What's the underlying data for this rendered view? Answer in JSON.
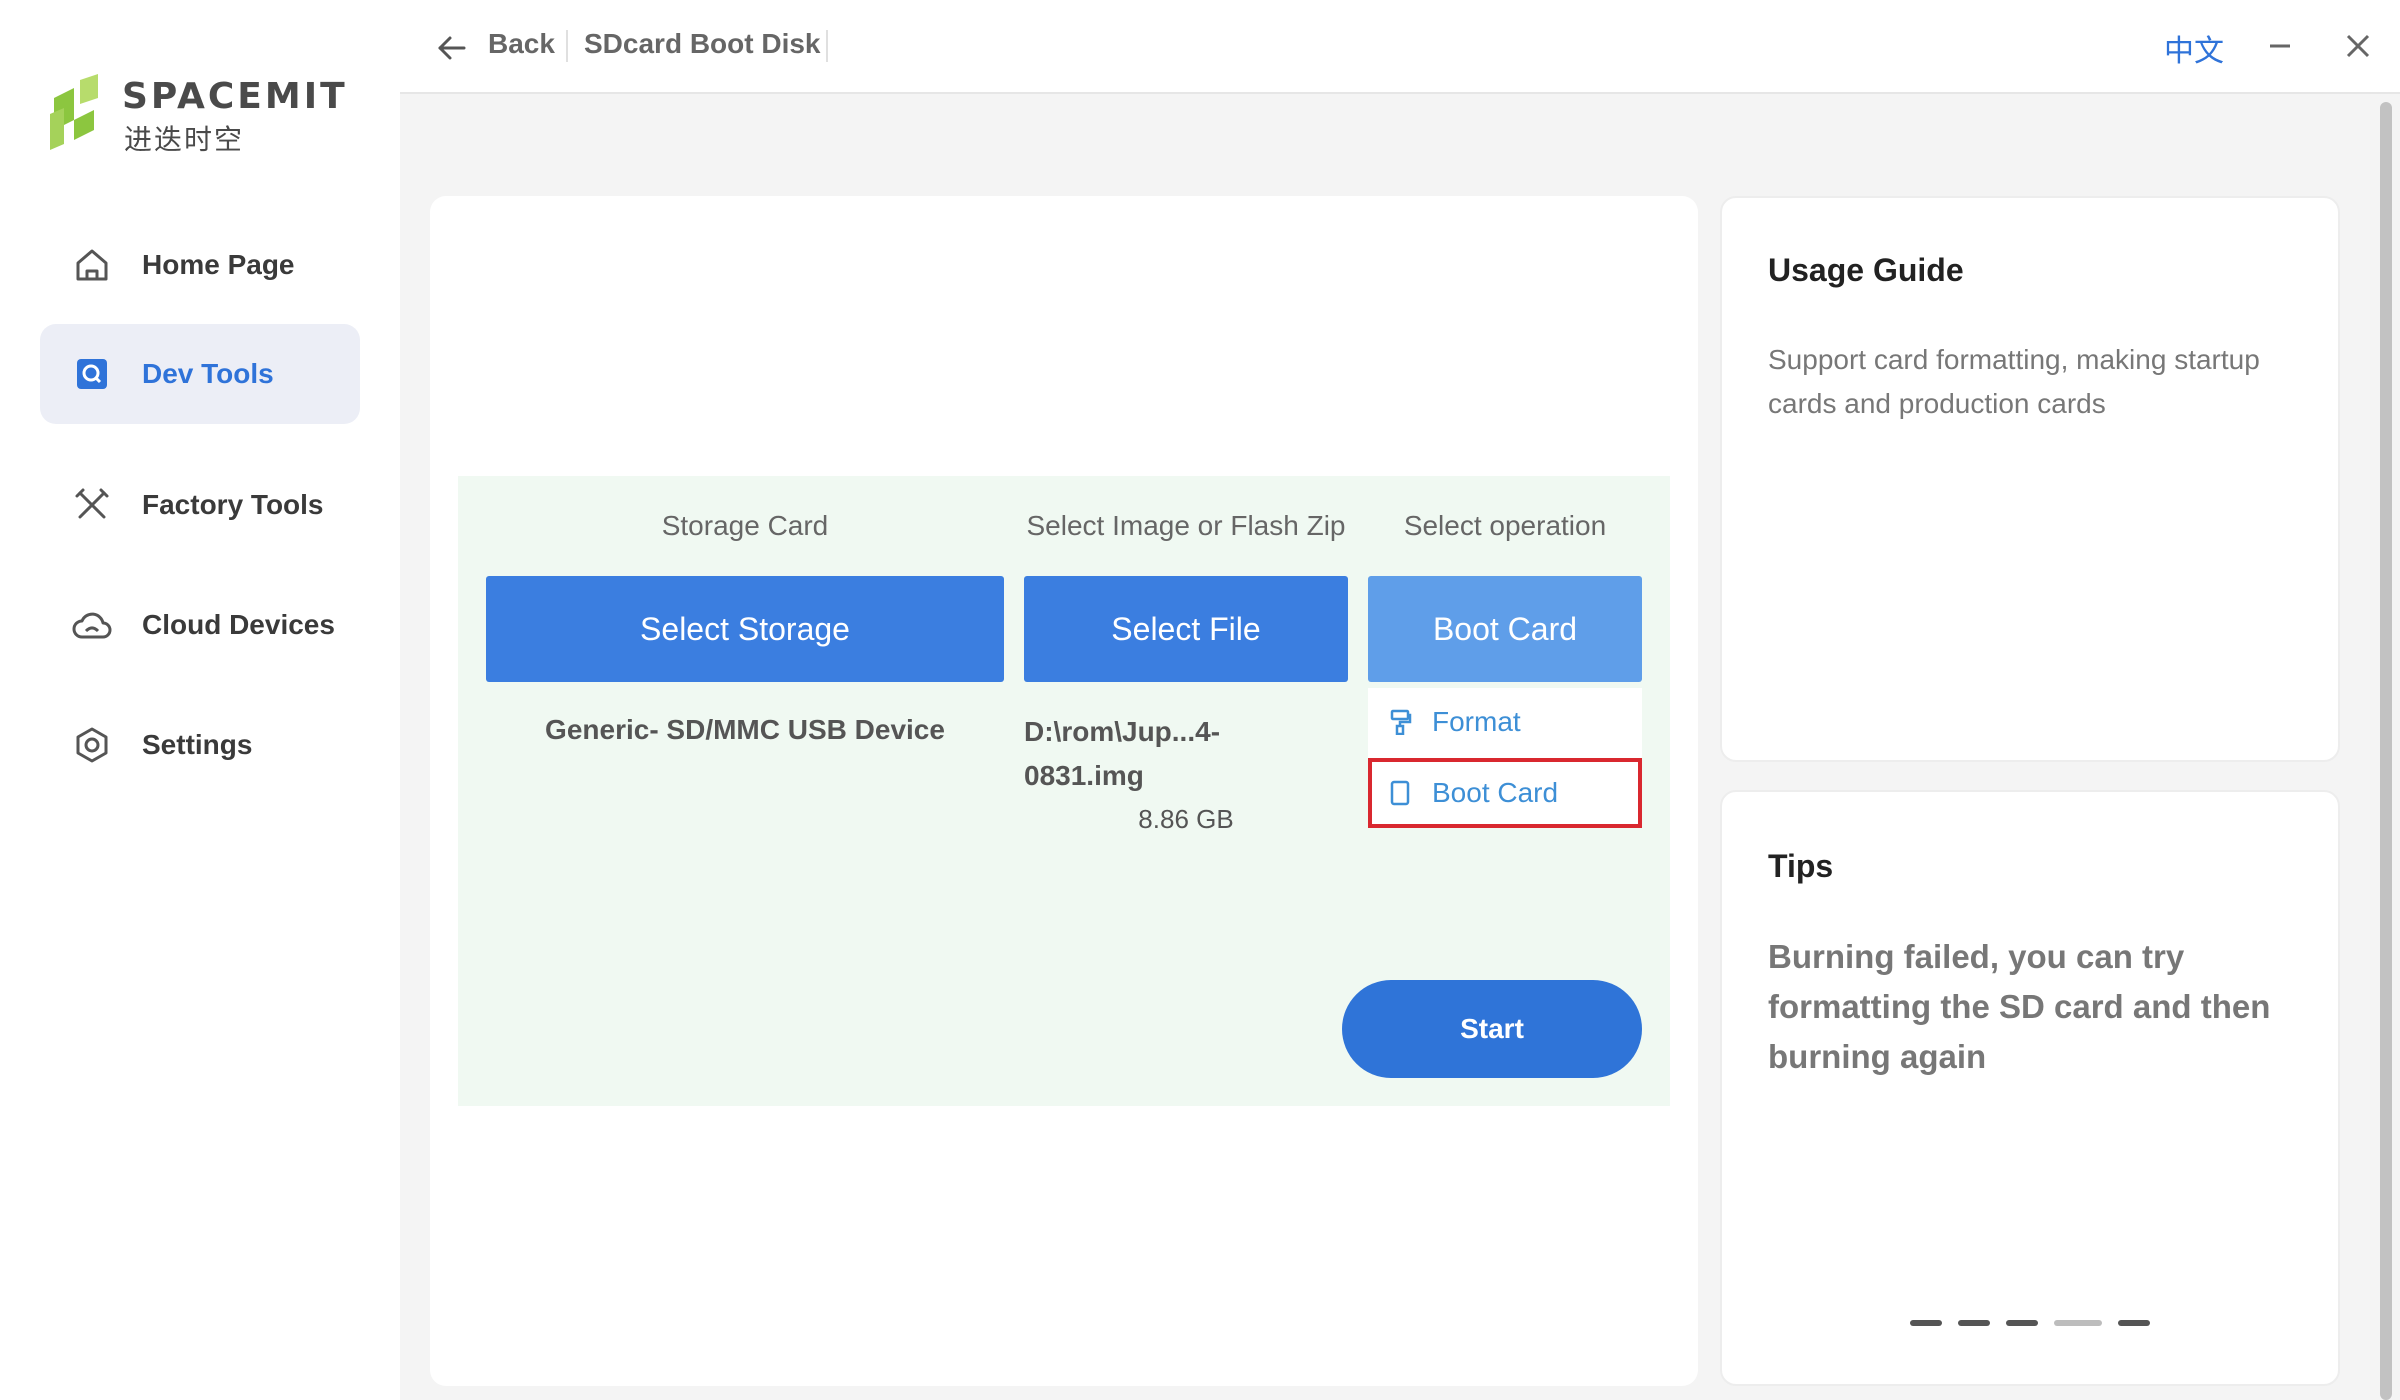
{
  "app": {
    "logo_text": "SPACEMIT",
    "logo_subtitle": "进迭时空",
    "accent_color": "#2f73d9"
  },
  "sidebar": {
    "items": [
      {
        "label": "Home Page",
        "icon": "home-icon"
      },
      {
        "label": "Dev Tools",
        "icon": "dev-tools-icon",
        "active": true
      },
      {
        "label": "Factory Tools",
        "icon": "tools-icon"
      },
      {
        "label": "Cloud Devices",
        "icon": "cloud-icon"
      },
      {
        "label": "Settings",
        "icon": "settings-icon"
      }
    ]
  },
  "header": {
    "back_label": "Back",
    "title": "SDcard Boot Disk",
    "language": "中文"
  },
  "main": {
    "columns": {
      "storage_label": "Storage Card",
      "image_label": "Select Image or Flash Zip",
      "operation_label": "Select operation"
    },
    "buttons": {
      "select_storage": "Select Storage",
      "select_file": "Select File",
      "operation": "Boot Card"
    },
    "device_name": "Generic- SD/MMC USB Device",
    "file": {
      "name": "D:\\rom\\Jup...4-0831.img",
      "size": "8.86 GB"
    },
    "operation_options": [
      {
        "label": "Format",
        "icon": "format-paint-icon"
      },
      {
        "label": "Boot Card",
        "icon": "sd-card-icon",
        "selected": true
      }
    ],
    "start_label": "Start"
  },
  "usage_guide": {
    "title": "Usage Guide",
    "text": "Support card formatting, making startup cards and production cards"
  },
  "tips": {
    "title": "Tips",
    "text": "Burning failed, you can try formatting the SD card and then burning again",
    "pagination_count": 5,
    "active_index": 3
  }
}
